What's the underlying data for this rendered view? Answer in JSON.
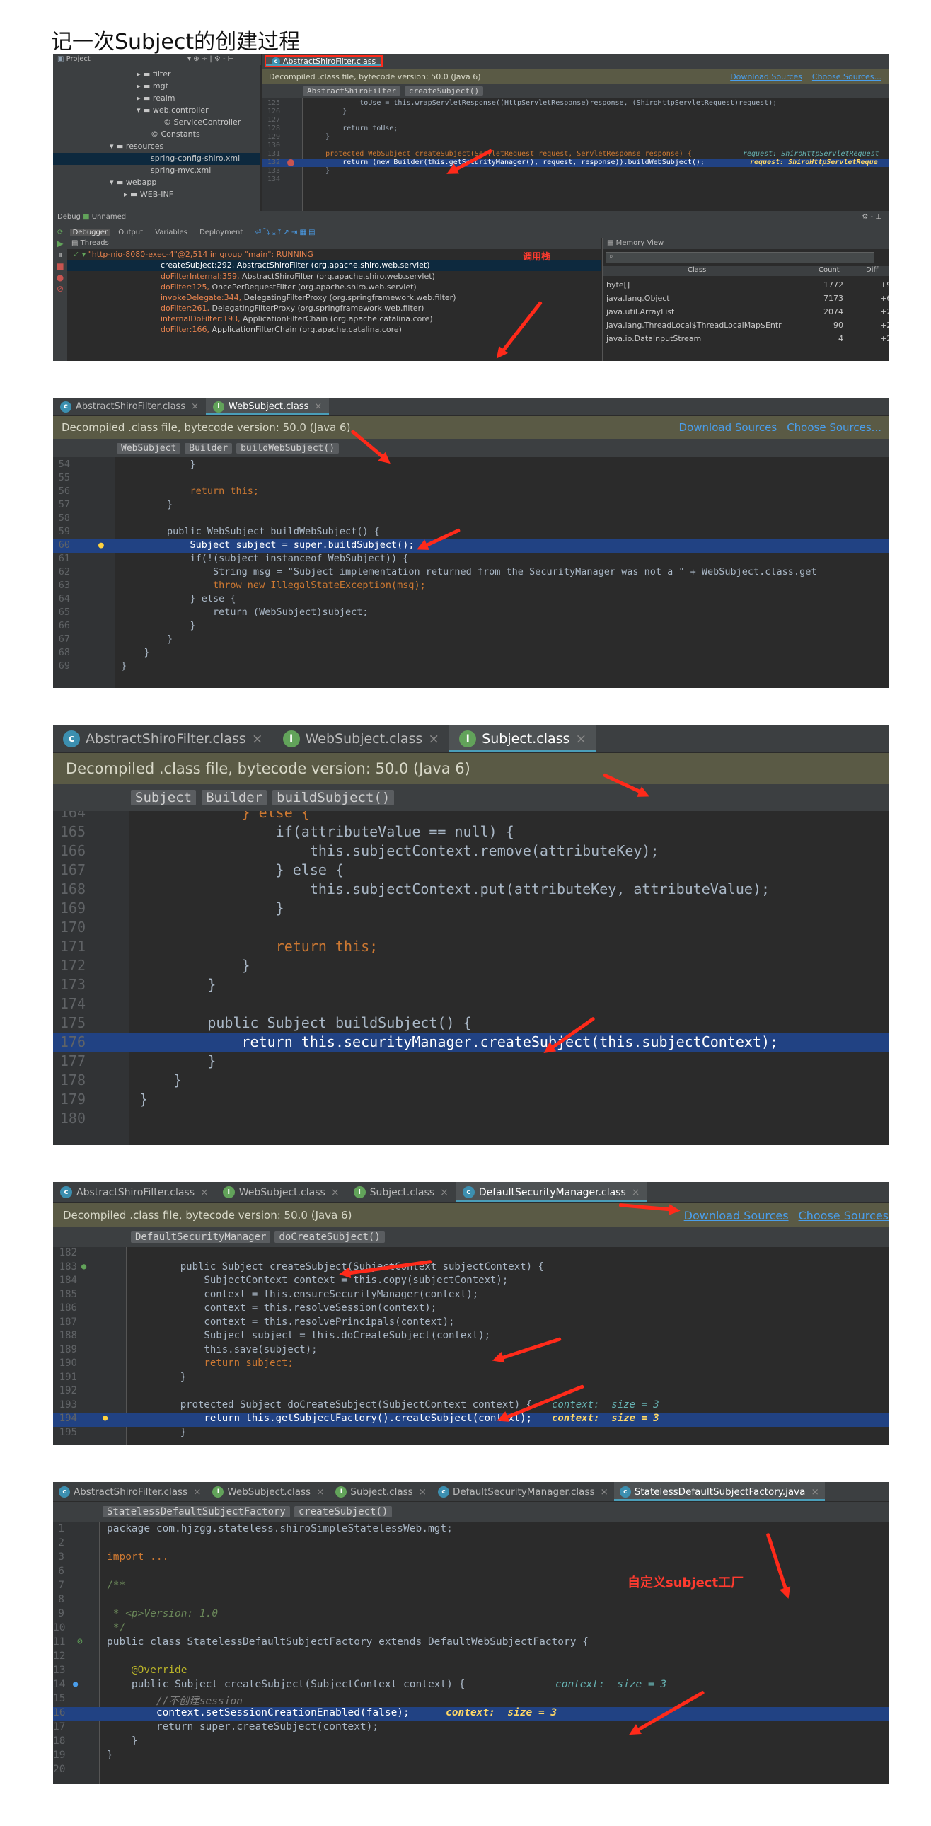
{
  "doc_title": "记一次Subject的创建过程",
  "shot1": {
    "project_label": "Project",
    "tree": [
      {
        "text": "▸ ▬ filter"
      },
      {
        "text": "▸ ▬ mgt"
      },
      {
        "text": "▸ ▬ realm"
      },
      {
        "text": "▾ ▬ web.controller"
      },
      {
        "text": "© ServiceController"
      },
      {
        "text": "© Constants"
      },
      {
        "text": "▾ ▬ resources"
      },
      {
        "text": "spring-config-shiro.xml"
      },
      {
        "text": "spring-mvc.xml"
      },
      {
        "text": "▾ ▬ webapp"
      },
      {
        "text": "▸ ▬ WEB-INF"
      }
    ],
    "tab": "AbstractShiroFilter.class",
    "info": "Decompiled .class file, bytecode version: 50.0 (Java 6)",
    "download_sources": "Download Sources",
    "choose_sources": "Choose Sources...",
    "crumbs": [
      "AbstractShiroFilter",
      "createSubject()"
    ],
    "lines": [
      {
        "n": "125",
        "t": "            toUse = this.wrapServletResponse((HttpServletResponse)response, (ShiroHttpServletRequest)request);"
      },
      {
        "n": "126",
        "t": "        }"
      },
      {
        "n": "127",
        "t": ""
      },
      {
        "n": "128",
        "t": "        return toUse;"
      },
      {
        "n": "129",
        "t": "    }"
      },
      {
        "n": "130",
        "t": ""
      },
      {
        "n": "131",
        "t": "    protected WebSubject createSubject(ServletRequest request, ServletResponse response) {"
      },
      {
        "n": "132",
        "t": "        return (new Builder(this.getSecurityManager(), request, response)).buildWebSubject();"
      },
      {
        "n": "133",
        "t": "    }"
      },
      {
        "n": "134",
        "t": ""
      }
    ],
    "inlay_1": "request: ShiroHttpServletRequest",
    "inlay_2": "request: ShiroHttpServletReque",
    "debug_label": "Debug",
    "debug_config": "Unnamed",
    "debug_tabs": [
      "Debugger",
      "Output",
      "Variables",
      "Deployment"
    ],
    "threads_label": "Threads",
    "memory_label": "Memory View",
    "thread_main": "\"http-nio-8080-exec-4\"@2,514 in group \"main\": RUNNING",
    "frames": [
      {
        "name": "createSubject:292,",
        "rest": " AbstractShiroFilter (org.apache.shiro.web.servlet)"
      },
      {
        "name": "doFilterInternal:359,",
        "rest": " AbstractShiroFilter (org.apache.shiro.web.servlet)"
      },
      {
        "name": "doFilter:125,",
        "rest": " OncePerRequestFilter (org.apache.shiro.web.servlet)"
      },
      {
        "name": "invokeDelegate:344,",
        "rest": " DelegatingFilterProxy (org.springframework.web.filter)"
      },
      {
        "name": "doFilter:261,",
        "rest": " DelegatingFilterProxy (org.springframework.web.filter)"
      },
      {
        "name": "internalDoFilter:193,",
        "rest": " ApplicationFilterChain (org.apache.catalina.core)"
      },
      {
        "name": "doFilter:166,",
        "rest": " ApplicationFilterChain (org.apache.catalina.core)"
      }
    ],
    "call_stack_label": "调用栈",
    "mem_headers": [
      "Class",
      "Count",
      "Diff"
    ],
    "mem_rows": [
      {
        "cls": "byte[]",
        "count": "1772",
        "diff": "+9"
      },
      {
        "cls": "java.lang.Object",
        "count": "7173",
        "diff": "+6"
      },
      {
        "cls": "java.util.ArrayList",
        "count": "2074",
        "diff": "+2"
      },
      {
        "cls": "java.lang.ThreadLocal$ThreadLocalMap$Entr",
        "count": "90",
        "diff": "+2"
      },
      {
        "cls": "java.io.DataInputStream",
        "count": "4",
        "diff": "+2"
      }
    ]
  },
  "shot2": {
    "tabs": [
      "AbstractShiroFilter.class",
      "WebSubject.class"
    ],
    "info": "Decompiled .class file, bytecode version: 50.0 (Java 6)",
    "download_sources": "Download Sources",
    "choose_sources": "Choose Sources...",
    "crumbs": [
      "WebSubject",
      "Builder",
      "buildWebSubject()"
    ],
    "lines": [
      {
        "n": "54",
        "t": "            }"
      },
      {
        "n": "55",
        "t": ""
      },
      {
        "n": "56",
        "t": "            return this;"
      },
      {
        "n": "57",
        "t": "        }"
      },
      {
        "n": "58",
        "t": ""
      },
      {
        "n": "59",
        "t": "        public WebSubject buildWebSubject() {"
      },
      {
        "n": "60",
        "t": "            Subject subject = super.buildSubject();"
      },
      {
        "n": "61",
        "t": "            if(!(subject instanceof WebSubject)) {"
      },
      {
        "n": "62",
        "t": "                String msg = \"Subject implementation returned from the SecurityManager was not a \" + WebSubject.class.get"
      },
      {
        "n": "63",
        "t": "                throw new IllegalStateException(msg);"
      },
      {
        "n": "64",
        "t": "            } else {"
      },
      {
        "n": "65",
        "t": "                return (WebSubject)subject;"
      },
      {
        "n": "66",
        "t": "            }"
      },
      {
        "n": "67",
        "t": "        }"
      },
      {
        "n": "68",
        "t": "    }"
      },
      {
        "n": "69",
        "t": "}"
      }
    ]
  },
  "shot3": {
    "tabs": [
      "AbstractShiroFilter.class",
      "WebSubject.class",
      "Subject.class"
    ],
    "info": "Decompiled .class file, bytecode version: 50.0 (Java 6)",
    "crumbs": [
      "Subject",
      "Builder",
      "buildSubject()"
    ],
    "lines": [
      {
        "n": "164",
        "t": "            } else {"
      },
      {
        "n": "165",
        "t": "                if(attributeValue == null) {"
      },
      {
        "n": "166",
        "t": "                    this.subjectContext.remove(attributeKey);"
      },
      {
        "n": "167",
        "t": "                } else {"
      },
      {
        "n": "168",
        "t": "                    this.subjectContext.put(attributeKey, attributeValue);"
      },
      {
        "n": "169",
        "t": "                }"
      },
      {
        "n": "170",
        "t": ""
      },
      {
        "n": "171",
        "t": "                return this;"
      },
      {
        "n": "172",
        "t": "            }"
      },
      {
        "n": "173",
        "t": "        }"
      },
      {
        "n": "174",
        "t": ""
      },
      {
        "n": "175",
        "t": "        public Subject buildSubject() {"
      },
      {
        "n": "176",
        "t": "            return this.securityManager.createSubject(this.subjectContext);"
      },
      {
        "n": "177",
        "t": "        }"
      },
      {
        "n": "178",
        "t": "    }"
      },
      {
        "n": "179",
        "t": "}"
      },
      {
        "n": "180",
        "t": ""
      }
    ]
  },
  "shot4": {
    "tabs": [
      "AbstractShiroFilter.class",
      "WebSubject.class",
      "Subject.class",
      "DefaultSecurityManager.class"
    ],
    "info": "Decompiled .class file, bytecode version: 50.0 (Java 6)",
    "download_sources": "Download Sources",
    "choose_sources": "Choose Sources",
    "crumbs": [
      "DefaultSecurityManager",
      "doCreateSubject()"
    ],
    "lines": [
      {
        "n": "182",
        "t": ""
      },
      {
        "n": "183",
        "t": "    public Subject createSubject(SubjectContext subjectContext) {"
      },
      {
        "n": "184",
        "t": "        SubjectContext context = this.copy(subjectContext);"
      },
      {
        "n": "185",
        "t": "        context = this.ensureSecurityManager(context);"
      },
      {
        "n": "186",
        "t": "        context = this.resolveSession(context);"
      },
      {
        "n": "187",
        "t": "        context = this.resolvePrincipals(context);"
      },
      {
        "n": "188",
        "t": "        Subject subject = this.doCreateSubject(context);"
      },
      {
        "n": "189",
        "t": "        this.save(subject);"
      },
      {
        "n": "190",
        "t": "        return subject;"
      },
      {
        "n": "191",
        "t": "    }"
      },
      {
        "n": "192",
        "t": ""
      },
      {
        "n": "193",
        "t": "    protected Subject doCreateSubject(SubjectContext context) {"
      },
      {
        "n": "194",
        "t": "        return this.getSubjectFactory().createSubject(context);"
      },
      {
        "n": "195",
        "t": "    }"
      }
    ],
    "inlay_1": "context:  size = 3",
    "inlay_2": "context:  size = 3"
  },
  "shot5": {
    "tabs": [
      "AbstractShiroFilter.class",
      "WebSubject.class",
      "Subject.class",
      "DefaultSecurityManager.class",
      "StatelessDefaultSubjectFactory.java"
    ],
    "crumbs": [
      "StatelessDefaultSubjectFactory",
      "createSubject()"
    ],
    "lines": [
      {
        "n": "1",
        "t": "package com.hjzgg.stateless.shiroSimpleStatelessWeb.mgt;"
      },
      {
        "n": "2",
        "t": ""
      },
      {
        "n": "3",
        "t": "import ..."
      },
      {
        "n": "6",
        "t": ""
      },
      {
        "n": "7",
        "t": "/**"
      },
      {
        "n": "8",
        "t": ""
      },
      {
        "n": "9",
        "t": " * <p>Version: 1.0"
      },
      {
        "n": "10",
        "t": " */"
      },
      {
        "n": "11",
        "t": "public class StatelessDefaultSubjectFactory extends DefaultWebSubjectFactory {"
      },
      {
        "n": "12",
        "t": ""
      },
      {
        "n": "13",
        "t": "    @Override"
      },
      {
        "n": "14",
        "t": "    public Subject createSubject(SubjectContext context) {"
      },
      {
        "n": "15",
        "t": "        //不创建session"
      },
      {
        "n": "16",
        "t": "        context.setSessionCreationEnabled(false);"
      },
      {
        "n": "17",
        "t": "        return super.createSubject(context);"
      },
      {
        "n": "18",
        "t": "    }"
      },
      {
        "n": "19",
        "t": "}"
      },
      {
        "n": "20",
        "t": ""
      }
    ],
    "inlay_1": "context:  size = 3",
    "inlay_2": "context:  size = 3",
    "custom_label": "自定义subject工厂"
  },
  "colors": {
    "accent_red": "#ff2a1a",
    "editor_bg": "#2b2b2b",
    "highlight": "#214283",
    "tab_underline": "#4a9eb9"
  }
}
